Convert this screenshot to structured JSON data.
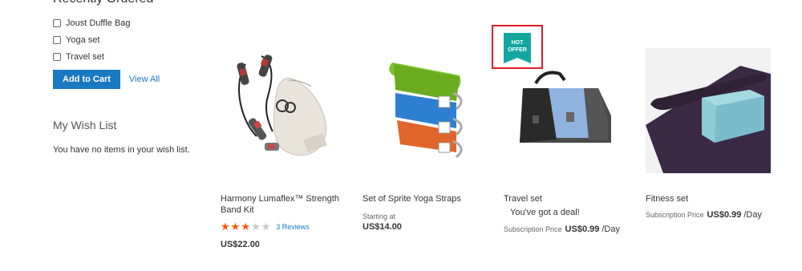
{
  "recently_ordered": {
    "title_partial": "Recently Ordered",
    "items": [
      "Joust Duffle Bag",
      "Yoga set",
      "Travel set"
    ],
    "add_to_cart_label": "Add to Cart",
    "view_all_label": "View All"
  },
  "wishlist": {
    "title": "My Wish List",
    "empty_text": "You have no items in your wish list."
  },
  "products": [
    {
      "name": "Harmony Lumaflex™ Strength Band Kit",
      "rating": 3,
      "max_rating": 5,
      "reviews_label": "3  Reviews",
      "price": "US$22.00"
    },
    {
      "name": "Set of Sprite Yoga Straps",
      "starting_at_label": "Starting at",
      "price": "US$14.00"
    },
    {
      "name": "Travel set",
      "deal_text": "You've got a deal!",
      "subscription_label": "Subscription Price",
      "subscription_price": "US$0.99",
      "per": "/Day",
      "badge": "HOT OFFER"
    },
    {
      "name": "Fitness set",
      "subscription_label": "Subscription Price",
      "subscription_price": "US$0.99",
      "per": "/Day"
    }
  ]
}
